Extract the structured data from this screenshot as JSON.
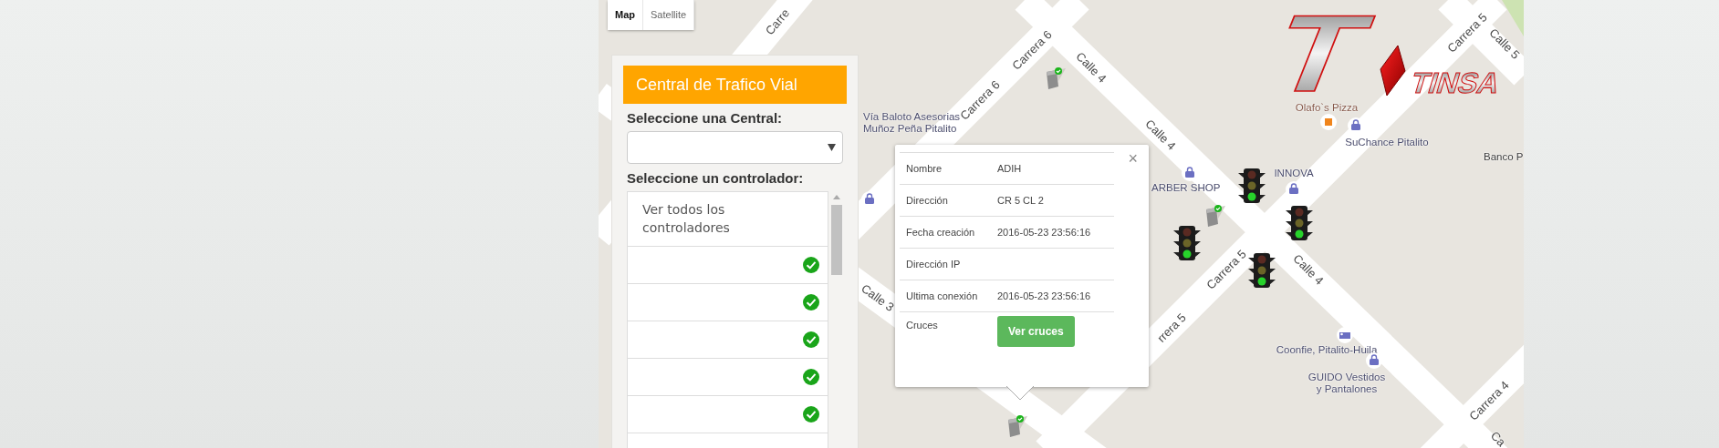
{
  "map_type": [
    {
      "label": "Map",
      "selected": true
    },
    {
      "label": "Satellite",
      "selected": false
    }
  ],
  "panel": {
    "title": "Central de Trafico Vial",
    "central_label": "Seleccione una Central:",
    "controller_label": "Seleccione un controlador:",
    "all_option": "Ver todos los controladores",
    "controllers": [
      {
        "online": true
      },
      {
        "online": true
      },
      {
        "online": true
      },
      {
        "online": true
      },
      {
        "online": true
      }
    ]
  },
  "popup": {
    "close": "×",
    "rows": [
      {
        "label": "Nombre",
        "value": "ADIH"
      },
      {
        "label": "Dirección",
        "value": "CR 5 CL 2"
      },
      {
        "label": "Fecha creación",
        "value": "2016-05-23 23:56:16"
      },
      {
        "label": "Dirección IP"
      },
      {
        "label": "Ultima conexión",
        "value": "2016-05-23 23:56:16"
      },
      {
        "label": "Cruces",
        "button": "Ver cruces"
      }
    ]
  },
  "logo": {
    "letter": "T",
    "name": "TINSA"
  },
  "streets": [
    "Carre",
    "Carrera 6",
    "Carrera 6",
    "Calle 4",
    "Calle 4",
    "Calle 4",
    "Carrera 5",
    "Carrera 5",
    "rrera 5",
    "Calle 5",
    "Calle 3",
    "Carrera 4",
    "Ca"
  ],
  "places": [
    {
      "text": "Olafo`s Pizza",
      "kind": "food"
    },
    {
      "text": "SuChance Pitalito",
      "kind": "shop"
    },
    {
      "text": "Banco P",
      "kind": "plain"
    },
    {
      "text": "INNOVA",
      "kind": "shop"
    },
    {
      "text": "ARBER SHOP",
      "kind": "shop"
    },
    {
      "text": "Coonfie, Pitalito-Huila",
      "kind": "bank"
    },
    {
      "text": "GUIDO Vestidos\ny Pantalones",
      "kind": "shop"
    },
    {
      "text": "Vía Baloto Asesorias\nMuñoz Peña Pitalito",
      "kind": "shop"
    }
  ]
}
